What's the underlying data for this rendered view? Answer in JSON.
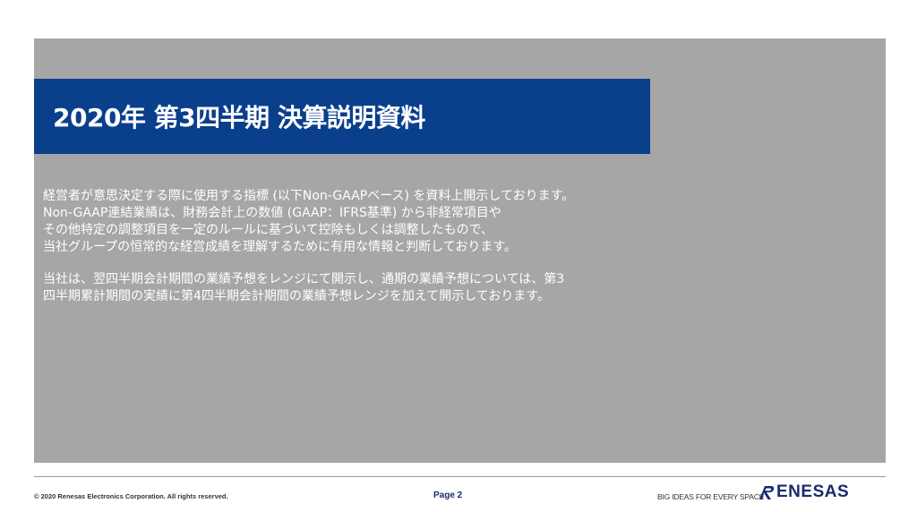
{
  "slide": {
    "title": "2020年 第3四半期 決算説明資料",
    "paragraphs": [
      {
        "lines": [
          "経営者が意思決定する際に使用する指標 (以下Non-GAAPベース) を資料上開示しております。",
          "Non-GAAP連結業績は、財務会計上の数値 (GAAP：IFRS基準) から非経常項目や",
          "その他特定の調整項目を一定のルールに基づいて控除もしくは調整したもので、",
          "当社グループの恒常的な経営成績を理解するために有用な情報と判断しております。"
        ]
      },
      {
        "lines": [
          "当社は、翌四半期会計期間の業績予想をレンジにて開示し、通期の業績予想については、第3",
          "四半期累計期間の実績に第4四半期会計期間の業績予想レンジを加えて開示しております。"
        ]
      }
    ]
  },
  "footer": {
    "copyright": "© 2020 Renesas Electronics Corporation. All rights reserved.",
    "page_label": "Page 2",
    "tagline": "BIG IDEAS FOR EVERY SPACE",
    "logo_text": "ENESAS"
  },
  "colors": {
    "title_bar": "#0a3f8c",
    "panel": "#a6a6a6",
    "brand": "#1a2b6b"
  },
  "icons": {
    "logo_mark": "renesas-r-icon"
  }
}
